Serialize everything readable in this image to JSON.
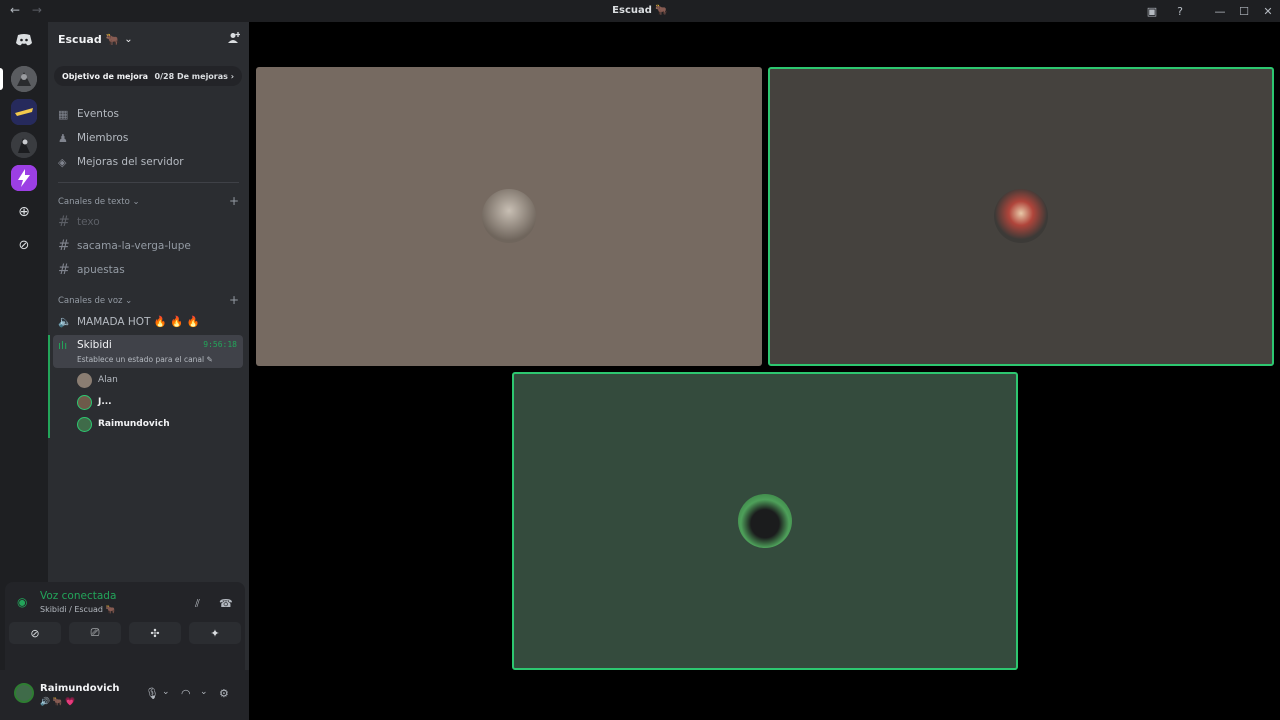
{
  "titlebar": {
    "back": "←",
    "forward": "→",
    "title": "Escuad 🐂",
    "inbox_icon": "▣",
    "help_icon": "?",
    "minimize": "—",
    "maximize": "☐",
    "close": "✕"
  },
  "server": {
    "name": "Escuad 🐂",
    "boost_goal": "Objetivo de mejora",
    "boost_progress": "0/28 De mejoras ›",
    "menu": {
      "events": "Eventos",
      "members": "Miembros",
      "boosts": "Mejoras del servidor"
    },
    "text_category": "Canales de texto ⌄",
    "voice_category": "Canales de voz ⌄",
    "text_channels": [
      "texo",
      "sacama-la-verga-lupe",
      "apuestas"
    ],
    "voice_channel_1": "MAMADA HOT 🔥 🔥 🔥",
    "active_voice": {
      "name": "Skibidi",
      "timer": "9:56:18",
      "status": "Establece un estado para el canal ✎"
    },
    "voice_members": [
      "Alan",
      "J...",
      "Raimundovich"
    ]
  },
  "voice_panel": {
    "connected": "Voz conectada",
    "location": "Skibidi / Escuad 🐂"
  },
  "user": {
    "name": "Raimundovich",
    "status": "🔊 🐂 💗"
  },
  "colors": {
    "speaking": "#2dc770",
    "tile1": "#766a61",
    "tile2": "#45423e",
    "tile3": "#344b3d"
  }
}
